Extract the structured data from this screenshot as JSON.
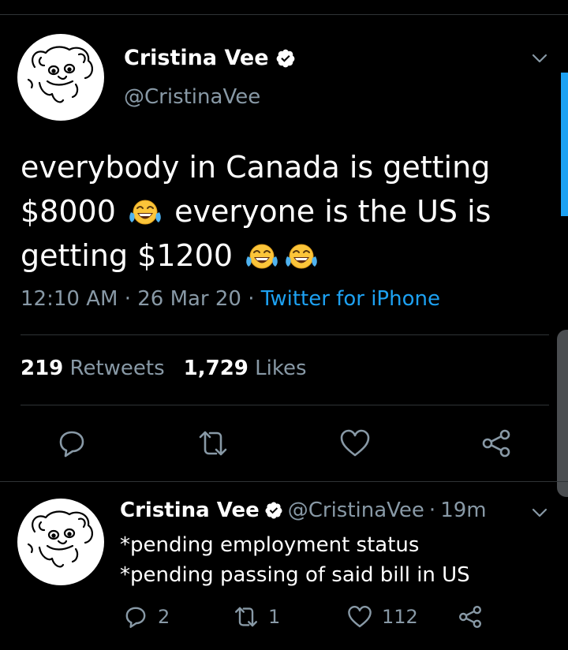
{
  "tweet": {
    "author_name": "Cristina Vee",
    "handle": "@CristinaVee",
    "text_line1": "everybody in Canada is getting",
    "text_line2a": "$8000",
    "text_line2b": "everyone is the US is",
    "text_line3": "getting $1200",
    "emoji": "face-with-tears-of-joy",
    "timestamp": "12:10 AM",
    "date": "26 Mar 20",
    "separator": "·",
    "source": "Twitter for iPhone",
    "retweets_count": "219",
    "retweets_label": "Retweets",
    "likes_count": "1,729",
    "likes_label": "Likes",
    "icons": {
      "reply": "reply-icon",
      "retweet": "retweet-icon",
      "like": "heart-icon",
      "share": "share-icon",
      "menu": "chevron-down-icon",
      "verified": "verified-badge-icon"
    }
  },
  "reply": {
    "author_name": "Cristina Vee",
    "handle": "@CristinaVee",
    "time": "19m",
    "separator": "·",
    "line1": "*pending employment status",
    "line2": "*pending passing of said bill in US",
    "replies": "2",
    "retweets": "1",
    "likes": "112"
  },
  "colors": {
    "background": "#000000",
    "text": "#ffffff",
    "secondary": "#8899a6",
    "link": "#1da1f2",
    "divider": "#2f3336",
    "verified_badge": "#ffffff"
  }
}
